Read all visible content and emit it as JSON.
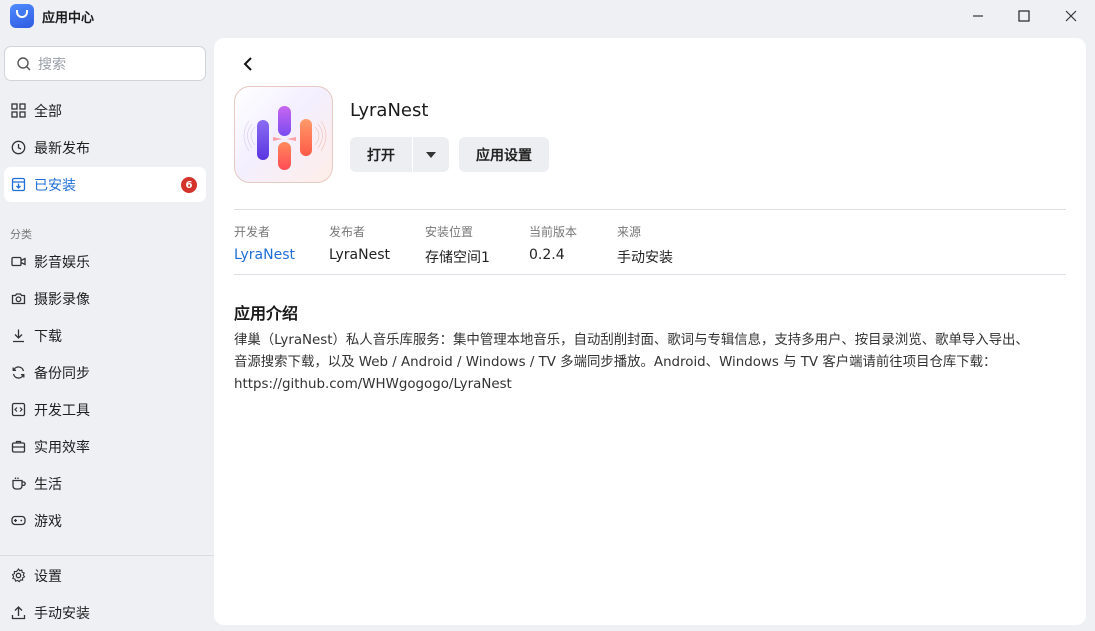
{
  "window": {
    "title": "应用中心",
    "logo_icon": "shopping-bag-icon",
    "controls": [
      "minimize-icon",
      "maximize-icon",
      "close-icon"
    ]
  },
  "sidebar": {
    "search_placeholder": "搜索",
    "items": [
      {
        "label": "全部",
        "icon": "grid-icon"
      },
      {
        "label": "最新发布",
        "icon": "clock-icon"
      },
      {
        "label": "已安装",
        "icon": "install-box-icon",
        "active": true,
        "badge": "6"
      }
    ],
    "category_title": "分类",
    "categories": [
      {
        "label": "影音娱乐",
        "icon": "video-camera-icon"
      },
      {
        "label": "摄影录像",
        "icon": "camera-icon"
      },
      {
        "label": "下载",
        "icon": "download-icon"
      },
      {
        "label": "备份同步",
        "icon": "sync-icon"
      },
      {
        "label": "开发工具",
        "icon": "code-icon"
      },
      {
        "label": "实用效率",
        "icon": "briefcase-icon"
      },
      {
        "label": "生活",
        "icon": "coffee-cup-icon"
      },
      {
        "label": "游戏",
        "icon": "gamepad-icon"
      }
    ],
    "bottom": [
      {
        "label": "设置",
        "icon": "gear-icon"
      },
      {
        "label": "手动安装",
        "icon": "upload-icon"
      }
    ],
    "colors": {
      "active_text": "#1f6fd6",
      "badge": "#d4322b"
    }
  },
  "app": {
    "name": "LyraNest",
    "open_label": "打开",
    "settings_label": "应用设置",
    "meta": [
      {
        "key": "开发者",
        "value": "LyraNest",
        "link": true
      },
      {
        "key": "发布者",
        "value": "LyraNest"
      },
      {
        "key": "安装位置",
        "value": "存储空间1"
      },
      {
        "key": "当前版本",
        "value": "0.2.4"
      },
      {
        "key": "来源",
        "value": "手动安装"
      }
    ],
    "intro_title": "应用介绍",
    "intro_lines": [
      "律巢（LyraNest）私人音乐库服务：集中管理本地音乐，自动刮削封面、歌词与专辑信息，支持多用户、按目录浏览、歌单导入导出、",
      "音源搜索下载，以及 Web / Android / Windows / TV 多端同步播放。Android、Windows 与 TV 客户端请前往项目仓库下载：",
      "https://github.com/WHWgogogo/LyraNest"
    ]
  }
}
